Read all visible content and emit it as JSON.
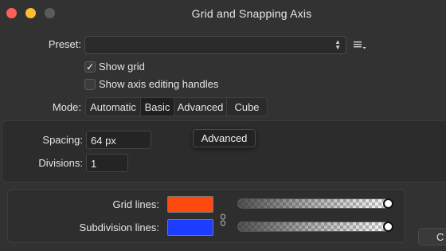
{
  "window": {
    "title": "Grid and Snapping Axis"
  },
  "preset": {
    "label": "Preset:",
    "value": ""
  },
  "checkboxes": [
    {
      "label": "Show grid",
      "checked": true
    },
    {
      "label": "Show axis editing handles",
      "checked": false
    }
  ],
  "mode": {
    "label": "Mode:",
    "options": [
      "Automatic",
      "Basic",
      "Advanced",
      "Cube"
    ],
    "selected": "Basic"
  },
  "spacing": {
    "label": "Spacing:",
    "value": "64 px"
  },
  "divisions": {
    "label": "Divisions:",
    "value": "1"
  },
  "tooltip": {
    "text": "Advanced"
  },
  "colors": {
    "grid_lines": {
      "label": "Grid lines:",
      "color": "#ff4a0f",
      "opacity": 1.0
    },
    "subdivision_lines": {
      "label": "Subdivision lines:",
      "color": "#1c3cff",
      "opacity": 1.0
    }
  },
  "corner_button": {
    "label": "C"
  }
}
